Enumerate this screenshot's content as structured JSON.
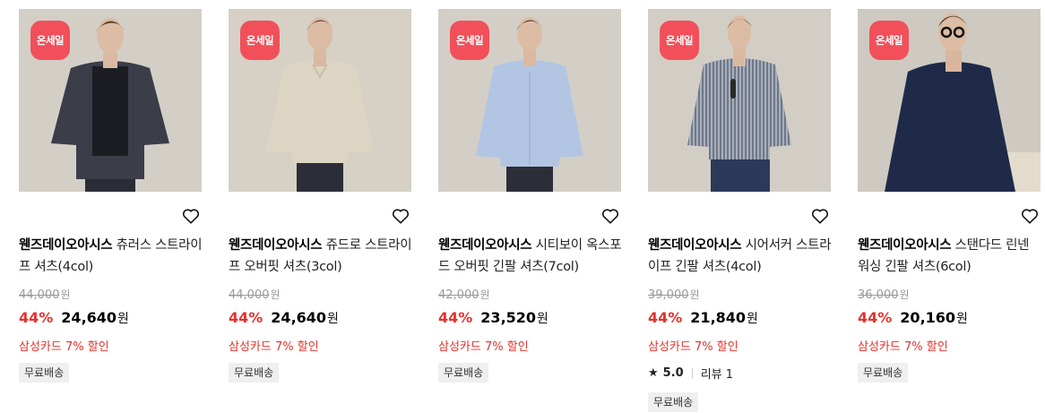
{
  "products": [
    {
      "badge": "온세일",
      "brand": "웬즈데이오아시스",
      "name": "츄러스 스트라이프 셔츠(4col)",
      "original_price": "44,000",
      "currency": "원",
      "discount": "44%",
      "sale_price": "24,640",
      "promo": "삼성카드 7% 할인",
      "rating": null,
      "reviews": null,
      "shipping": "무료배송",
      "shirt_color": "#3b3e48",
      "inner_color": "#1c1d22",
      "pants_color": "#2a2d35"
    },
    {
      "badge": "온세일",
      "brand": "웬즈데이오아시스",
      "name": "쥬드로 스트라이프 오버핏 셔츠(3col)",
      "original_price": "44,000",
      "currency": "원",
      "discount": "44%",
      "sale_price": "24,640",
      "promo": "삼성카드 7% 할인",
      "rating": null,
      "reviews": null,
      "shipping": "무료배송",
      "shirt_color": "#ddd5c3",
      "inner_color": "#ddd5c3",
      "pants_color": "#2b2e38"
    },
    {
      "badge": "온세일",
      "brand": "웬즈데이오아시스",
      "name": "시티보이 옥스포드 오버핏 긴팔 셔츠(7col)",
      "original_price": "42,000",
      "currency": "원",
      "discount": "44%",
      "sale_price": "23,520",
      "promo": "삼성카드 7% 할인",
      "rating": null,
      "reviews": null,
      "shipping": "무료배송",
      "shirt_color": "#b2c6e4",
      "inner_color": "#b2c6e4",
      "pants_color": "#2b2e38"
    },
    {
      "badge": "온세일",
      "brand": "웬즈데이오아시스",
      "name": "시어서커 스트라이프 긴팔 셔츠(4col)",
      "original_price": "39,000",
      "currency": "원",
      "discount": "44%",
      "sale_price": "21,840",
      "promo": "삼성카드 7% 할인",
      "rating": "5.0",
      "reviews": "리뷰 1",
      "shipping": "무료배송",
      "shirt_color": "#8f97a8",
      "inner_color": "#8f97a8",
      "pants_color": "#2c3a5a"
    },
    {
      "badge": "온세일",
      "brand": "웬즈데이오아시스",
      "name": "스탠다드 린넨 워싱 긴팔 셔츠(6col)",
      "original_price": "36,000",
      "currency": "원",
      "discount": "44%",
      "sale_price": "20,160",
      "promo": "삼성카드 7% 할인",
      "rating": null,
      "reviews": null,
      "shipping": "무료배송",
      "shirt_color": "#1e2a48",
      "inner_color": "#1e2a48",
      "pants_color": "#e3dccd"
    }
  ]
}
